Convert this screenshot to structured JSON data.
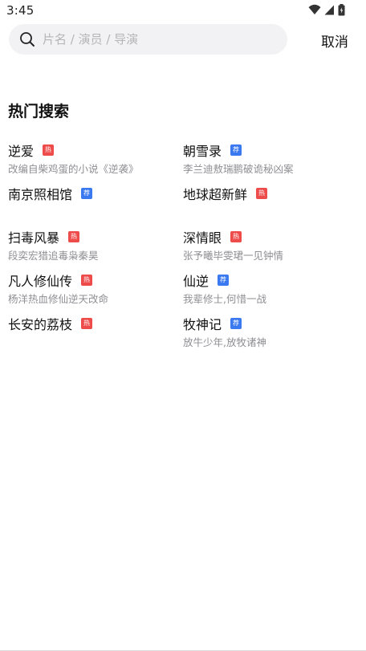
{
  "status_bar": {
    "time": "3:45",
    "icons": [
      "wifi-icon",
      "signal-icon",
      "battery-icon"
    ]
  },
  "search": {
    "placeholder": "片名 / 演员 / 导演",
    "value": "",
    "icon": "search-icon"
  },
  "cancel_label": "取消",
  "section_title": "热门搜索",
  "badge_labels": {
    "hot": "热",
    "rec": "荐"
  },
  "colors": {
    "hot_badge": "#ee4b4b",
    "rec_badge": "#3b79f0",
    "desc_text": "#8f8f94"
  },
  "hot_items": [
    {
      "title": "逆爱",
      "badge": "hot",
      "desc": "改编自柴鸡蛋的小说《逆袭》"
    },
    {
      "title": "朝雪录",
      "badge": "rec",
      "desc": "李兰迪敖瑞鹏破诡秘凶案"
    },
    {
      "title": "南京照相馆",
      "badge": "rec",
      "desc": ""
    },
    {
      "title": "地球超新鲜",
      "badge": "hot",
      "desc": ""
    },
    {
      "title": "扫毒风暴",
      "badge": "hot",
      "desc": "段奕宏猎追毒枭秦昊"
    },
    {
      "title": "深情眼",
      "badge": "hot",
      "desc": "张予曦毕雯珺一见钟情"
    },
    {
      "title": "凡人修仙传",
      "badge": "hot",
      "desc": "杨洋热血修仙逆天改命"
    },
    {
      "title": "仙逆",
      "badge": "rec",
      "desc": "我辈修士,何惜一战"
    },
    {
      "title": "长安的荔枝",
      "badge": "hot",
      "desc": ""
    },
    {
      "title": "牧神记",
      "badge": "rec",
      "desc": "放牛少年,放牧诸神"
    }
  ]
}
